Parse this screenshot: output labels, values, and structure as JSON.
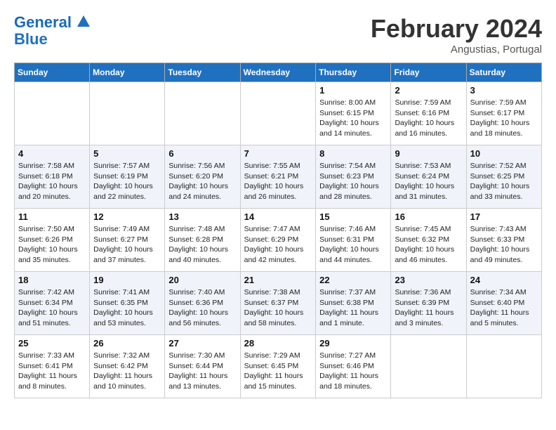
{
  "header": {
    "logo_line1": "General",
    "logo_line2": "Blue",
    "month": "February 2024",
    "location": "Angustias, Portugal"
  },
  "days_of_week": [
    "Sunday",
    "Monday",
    "Tuesday",
    "Wednesday",
    "Thursday",
    "Friday",
    "Saturday"
  ],
  "weeks": [
    {
      "stripe": false,
      "days": [
        {
          "date": "",
          "info": ""
        },
        {
          "date": "",
          "info": ""
        },
        {
          "date": "",
          "info": ""
        },
        {
          "date": "",
          "info": ""
        },
        {
          "date": "1",
          "info": "Sunrise: 8:00 AM\nSunset: 6:15 PM\nDaylight: 10 hours\nand 14 minutes."
        },
        {
          "date": "2",
          "info": "Sunrise: 7:59 AM\nSunset: 6:16 PM\nDaylight: 10 hours\nand 16 minutes."
        },
        {
          "date": "3",
          "info": "Sunrise: 7:59 AM\nSunset: 6:17 PM\nDaylight: 10 hours\nand 18 minutes."
        }
      ]
    },
    {
      "stripe": true,
      "days": [
        {
          "date": "4",
          "info": "Sunrise: 7:58 AM\nSunset: 6:18 PM\nDaylight: 10 hours\nand 20 minutes."
        },
        {
          "date": "5",
          "info": "Sunrise: 7:57 AM\nSunset: 6:19 PM\nDaylight: 10 hours\nand 22 minutes."
        },
        {
          "date": "6",
          "info": "Sunrise: 7:56 AM\nSunset: 6:20 PM\nDaylight: 10 hours\nand 24 minutes."
        },
        {
          "date": "7",
          "info": "Sunrise: 7:55 AM\nSunset: 6:21 PM\nDaylight: 10 hours\nand 26 minutes."
        },
        {
          "date": "8",
          "info": "Sunrise: 7:54 AM\nSunset: 6:23 PM\nDaylight: 10 hours\nand 28 minutes."
        },
        {
          "date": "9",
          "info": "Sunrise: 7:53 AM\nSunset: 6:24 PM\nDaylight: 10 hours\nand 31 minutes."
        },
        {
          "date": "10",
          "info": "Sunrise: 7:52 AM\nSunset: 6:25 PM\nDaylight: 10 hours\nand 33 minutes."
        }
      ]
    },
    {
      "stripe": false,
      "days": [
        {
          "date": "11",
          "info": "Sunrise: 7:50 AM\nSunset: 6:26 PM\nDaylight: 10 hours\nand 35 minutes."
        },
        {
          "date": "12",
          "info": "Sunrise: 7:49 AM\nSunset: 6:27 PM\nDaylight: 10 hours\nand 37 minutes."
        },
        {
          "date": "13",
          "info": "Sunrise: 7:48 AM\nSunset: 6:28 PM\nDaylight: 10 hours\nand 40 minutes."
        },
        {
          "date": "14",
          "info": "Sunrise: 7:47 AM\nSunset: 6:29 PM\nDaylight: 10 hours\nand 42 minutes."
        },
        {
          "date": "15",
          "info": "Sunrise: 7:46 AM\nSunset: 6:31 PM\nDaylight: 10 hours\nand 44 minutes."
        },
        {
          "date": "16",
          "info": "Sunrise: 7:45 AM\nSunset: 6:32 PM\nDaylight: 10 hours\nand 46 minutes."
        },
        {
          "date": "17",
          "info": "Sunrise: 7:43 AM\nSunset: 6:33 PM\nDaylight: 10 hours\nand 49 minutes."
        }
      ]
    },
    {
      "stripe": true,
      "days": [
        {
          "date": "18",
          "info": "Sunrise: 7:42 AM\nSunset: 6:34 PM\nDaylight: 10 hours\nand 51 minutes."
        },
        {
          "date": "19",
          "info": "Sunrise: 7:41 AM\nSunset: 6:35 PM\nDaylight: 10 hours\nand 53 minutes."
        },
        {
          "date": "20",
          "info": "Sunrise: 7:40 AM\nSunset: 6:36 PM\nDaylight: 10 hours\nand 56 minutes."
        },
        {
          "date": "21",
          "info": "Sunrise: 7:38 AM\nSunset: 6:37 PM\nDaylight: 10 hours\nand 58 minutes."
        },
        {
          "date": "22",
          "info": "Sunrise: 7:37 AM\nSunset: 6:38 PM\nDaylight: 11 hours\nand 1 minute."
        },
        {
          "date": "23",
          "info": "Sunrise: 7:36 AM\nSunset: 6:39 PM\nDaylight: 11 hours\nand 3 minutes."
        },
        {
          "date": "24",
          "info": "Sunrise: 7:34 AM\nSunset: 6:40 PM\nDaylight: 11 hours\nand 5 minutes."
        }
      ]
    },
    {
      "stripe": false,
      "days": [
        {
          "date": "25",
          "info": "Sunrise: 7:33 AM\nSunset: 6:41 PM\nDaylight: 11 hours\nand 8 minutes."
        },
        {
          "date": "26",
          "info": "Sunrise: 7:32 AM\nSunset: 6:42 PM\nDaylight: 11 hours\nand 10 minutes."
        },
        {
          "date": "27",
          "info": "Sunrise: 7:30 AM\nSunset: 6:44 PM\nDaylight: 11 hours\nand 13 minutes."
        },
        {
          "date": "28",
          "info": "Sunrise: 7:29 AM\nSunset: 6:45 PM\nDaylight: 11 hours\nand 15 minutes."
        },
        {
          "date": "29",
          "info": "Sunrise: 7:27 AM\nSunset: 6:46 PM\nDaylight: 11 hours\nand 18 minutes."
        },
        {
          "date": "",
          "info": ""
        },
        {
          "date": "",
          "info": ""
        }
      ]
    }
  ]
}
